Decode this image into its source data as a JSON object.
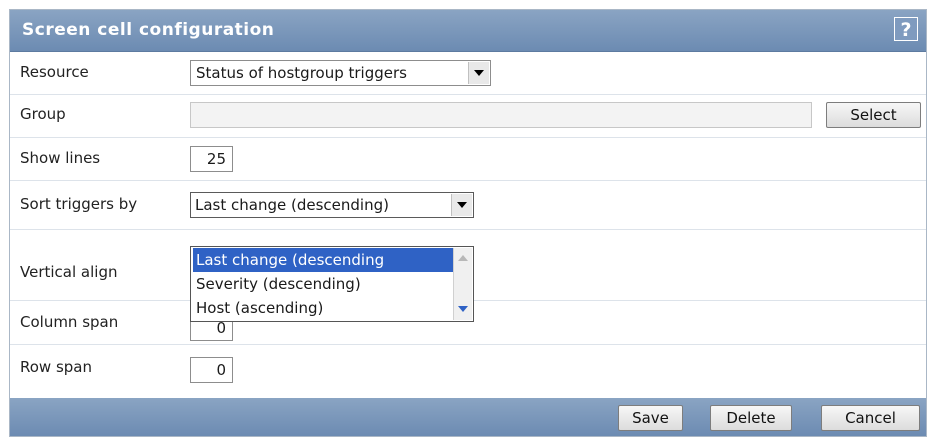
{
  "dialog": {
    "title": "Screen cell configuration",
    "help_label": "?"
  },
  "fields": {
    "resource": {
      "label": "Resource",
      "value": "Status of hostgroup triggers"
    },
    "group": {
      "label": "Group",
      "value": "",
      "select_label": "Select"
    },
    "show_lines": {
      "label": "Show lines",
      "value": "25"
    },
    "sort_triggers_by": {
      "label": "Sort triggers by",
      "value": "Last change (descending)",
      "options": [
        "Last change (descending",
        "Severity (descending)",
        "Host (ascending)"
      ]
    },
    "vertical_align": {
      "label": "Vertical align"
    },
    "column_span": {
      "label": "Column span",
      "value": "0"
    },
    "row_span": {
      "label": "Row span",
      "value": "0"
    }
  },
  "footer": {
    "save_label": "Save",
    "delete_label": "Delete",
    "cancel_label": "Cancel"
  },
  "colors": {
    "header": "#7b97bc",
    "selected_option": "#2f62c5"
  }
}
